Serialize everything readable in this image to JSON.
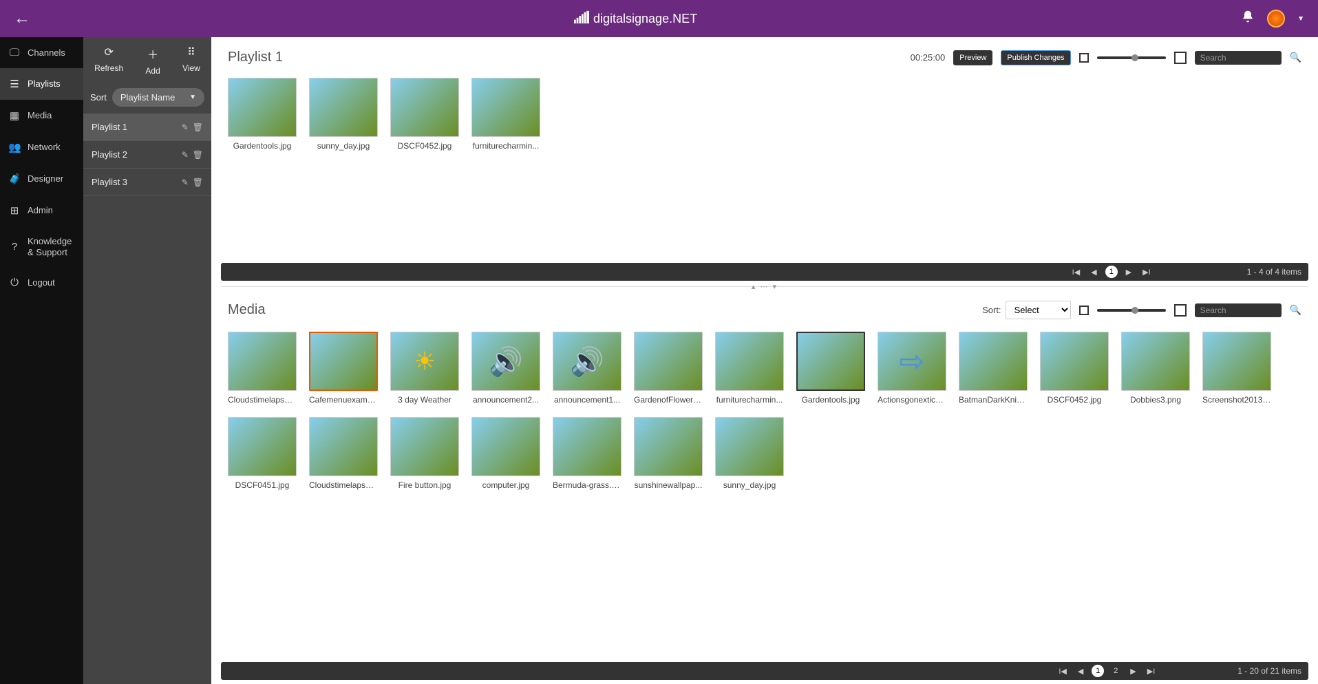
{
  "topbar": {
    "brand": "digitalsignage.NET"
  },
  "nav": {
    "channels": "Channels",
    "playlists": "Playlists",
    "media": "Media",
    "network": "Network",
    "designer": "Designer",
    "admin": "Admin",
    "knowledge": "Knowledge & Support",
    "logout": "Logout"
  },
  "plpanel": {
    "refresh": "Refresh",
    "add": "Add",
    "view": "View",
    "sort_label": "Sort",
    "sort_value": "Playlist Name",
    "items": [
      {
        "name": "Playlist 1"
      },
      {
        "name": "Playlist 2"
      },
      {
        "name": "Playlist 3"
      }
    ]
  },
  "playlist": {
    "title": "Playlist 1",
    "duration": "00:25:00",
    "preview": "Preview",
    "publish": "Publish Changes",
    "search_ph": "Search",
    "items": [
      {
        "name": "Gardentools.jpg",
        "ph": "ph-wood"
      },
      {
        "name": "sunny_day.jpg",
        "ph": "ph-sky"
      },
      {
        "name": "DSCF0452.jpg",
        "ph": "ph-forest"
      },
      {
        "name": "furniturecharmin...",
        "ph": "ph-patio"
      }
    ],
    "pager_text": "1 - 4 of 4 items",
    "pager_page": "1"
  },
  "media": {
    "title": "Media",
    "sort_label": "Sort:",
    "sort_value": "Select",
    "search_ph": "Search",
    "items": [
      {
        "name": "Cloudstimelapsec...",
        "ph": "ph-clouds"
      },
      {
        "name": "Cafemenuexampl...",
        "ph": "ph-menu"
      },
      {
        "name": "3 day Weather",
        "ph": "ph-weather"
      },
      {
        "name": "announcement2...",
        "ph": "ph-audio"
      },
      {
        "name": "announcement1...",
        "ph": "ph-audio"
      },
      {
        "name": "GardenofFlowers...",
        "ph": "ph-flowers"
      },
      {
        "name": "furniturecharmin...",
        "ph": "ph-patio"
      },
      {
        "name": "Gardentools.jpg",
        "ph": "ph-wood",
        "sel": true
      },
      {
        "name": "Actionsgonextico...",
        "ph": "ph-arrow"
      },
      {
        "name": "BatmanDarkKnig...",
        "ph": "ph-green"
      },
      {
        "name": "DSCF0452.jpg",
        "ph": "ph-forest"
      },
      {
        "name": "Dobbies3.png",
        "ph": "ph-pink"
      },
      {
        "name": "Screenshot20131...",
        "ph": "ph-dark"
      },
      {
        "name": "DSCF0451.jpg",
        "ph": "ph-forest"
      },
      {
        "name": "Cloudstimelapsec...",
        "ph": "ph-clouds"
      },
      {
        "name": "Fire button.jpg",
        "ph": "ph-fire"
      },
      {
        "name": "computer.jpg",
        "ph": "ph-computer"
      },
      {
        "name": "Bermuda-grass.jpg",
        "ph": "ph-grass"
      },
      {
        "name": "sunshinewallpap...",
        "ph": "ph-sun"
      },
      {
        "name": "sunny_day.jpg",
        "ph": "ph-field"
      }
    ],
    "pager_text": "1 - 20 of 21 items",
    "pager_page1": "1",
    "pager_page2": "2"
  }
}
